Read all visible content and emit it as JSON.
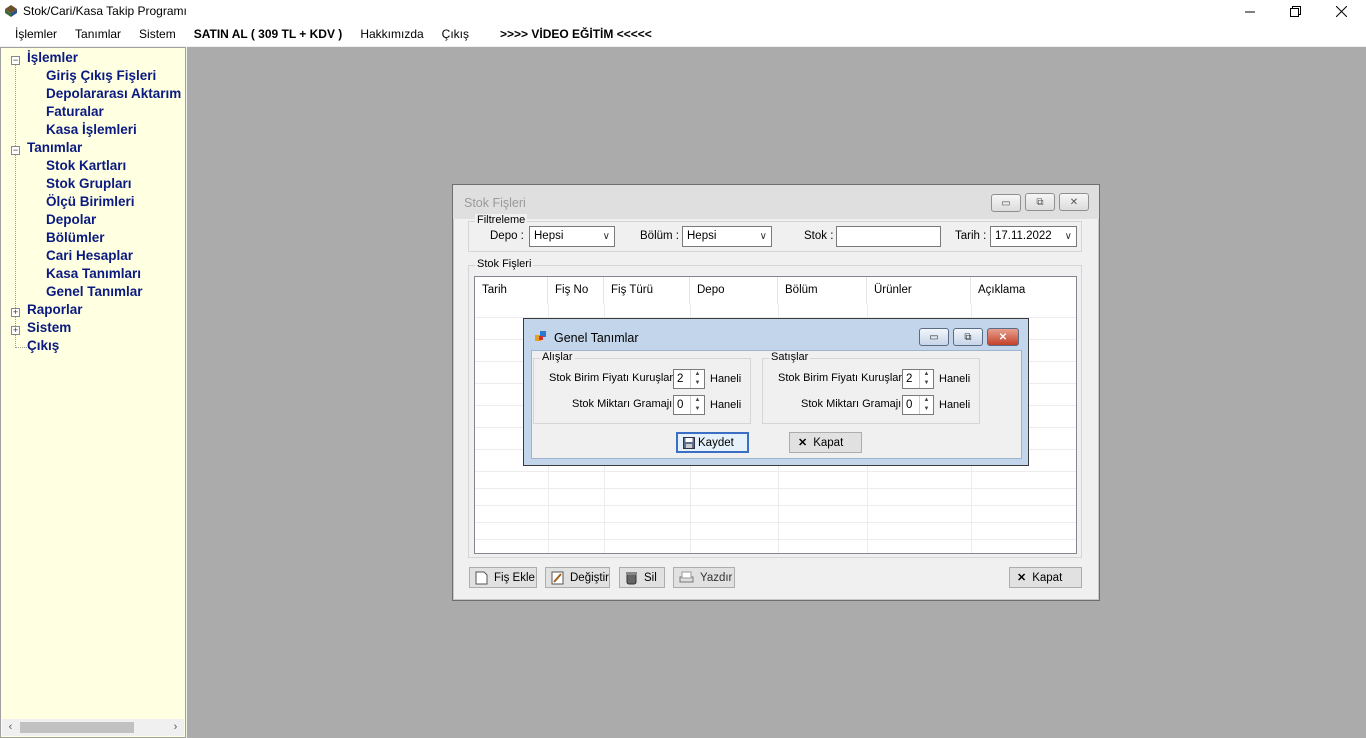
{
  "window": {
    "title": "Stok/Cari/Kasa Takip Programı"
  },
  "menu": [
    {
      "label": "İşlemler",
      "bold": false
    },
    {
      "label": "Tanımlar",
      "bold": false
    },
    {
      "label": "Sistem",
      "bold": false
    },
    {
      "label": "SATIN AL ( 309 TL + KDV )",
      "bold": true
    },
    {
      "label": "Hakkımızda",
      "bold": false
    },
    {
      "label": "Çıkış",
      "bold": false
    },
    {
      "label": ">>>> VİDEO EĞİTİM <<<<<",
      "bold": true
    }
  ],
  "tree": {
    "islemler": "İşlemler",
    "giris_cikis": "Giriş Çıkış Fişleri",
    "depolararasi": "Depolararası Aktarım",
    "faturalar": "Faturalar",
    "kasa_islemleri": "Kasa İşlemleri",
    "tanimlar": "Tanımlar",
    "stok_kartlari": "Stok Kartları",
    "stok_gruplari": "Stok Grupları",
    "olcu_birimleri": "Ölçü Birimleri",
    "depolar": "Depolar",
    "bolumler": "Bölümler",
    "cari_hesaplar": "Cari Hesaplar",
    "kasa_tanimlari": "Kasa Tanımları",
    "genel_tanimlar": "Genel Tanımlar",
    "raporlar": "Raporlar",
    "sistem": "Sistem",
    "cikis": "Çıkış"
  },
  "stok_fisleri": {
    "title": "Stok Fişleri",
    "filter_group": "Filtreleme",
    "depo_label": "Depo :",
    "depo_value": "Hepsi",
    "bolum_label": "Bölüm :",
    "bolum_value": "Hepsi",
    "stok_label": "Stok :",
    "stok_value": "",
    "tarih_label": "Tarih :",
    "tarih_value": "17.11.2022",
    "list_group": "Stok Fişleri",
    "columns": [
      "Tarih",
      "Fiş No",
      "Fiş Türü",
      "Depo",
      "Bölüm",
      "Ürünler",
      "Açıklama"
    ],
    "buttons": {
      "fis_ekle": "Fiş Ekle",
      "degistir": "Değiştir",
      "sil": "Sil",
      "yazdir": "Yazdır",
      "kapat": "Kapat"
    }
  },
  "genel_tanimlar": {
    "title": "Genel Tanımlar",
    "alislar": {
      "group": "Alışlar",
      "fiyat_label": "Stok Birim Fiyatı Kuruşları :",
      "fiyat_value": "2",
      "gramaj_label": "Stok Miktarı Gramajı :",
      "gramaj_value": "0",
      "haneli": "Haneli"
    },
    "satislar": {
      "group": "Satışlar",
      "fiyat_label": "Stok Birim Fiyatı Kuruşları :",
      "fiyat_value": "2",
      "gramaj_label": "Stok Miktarı Gramajı :",
      "gramaj_value": "0",
      "haneli": "Haneli"
    },
    "kaydet": "Kaydet",
    "kapat": "Kapat"
  }
}
